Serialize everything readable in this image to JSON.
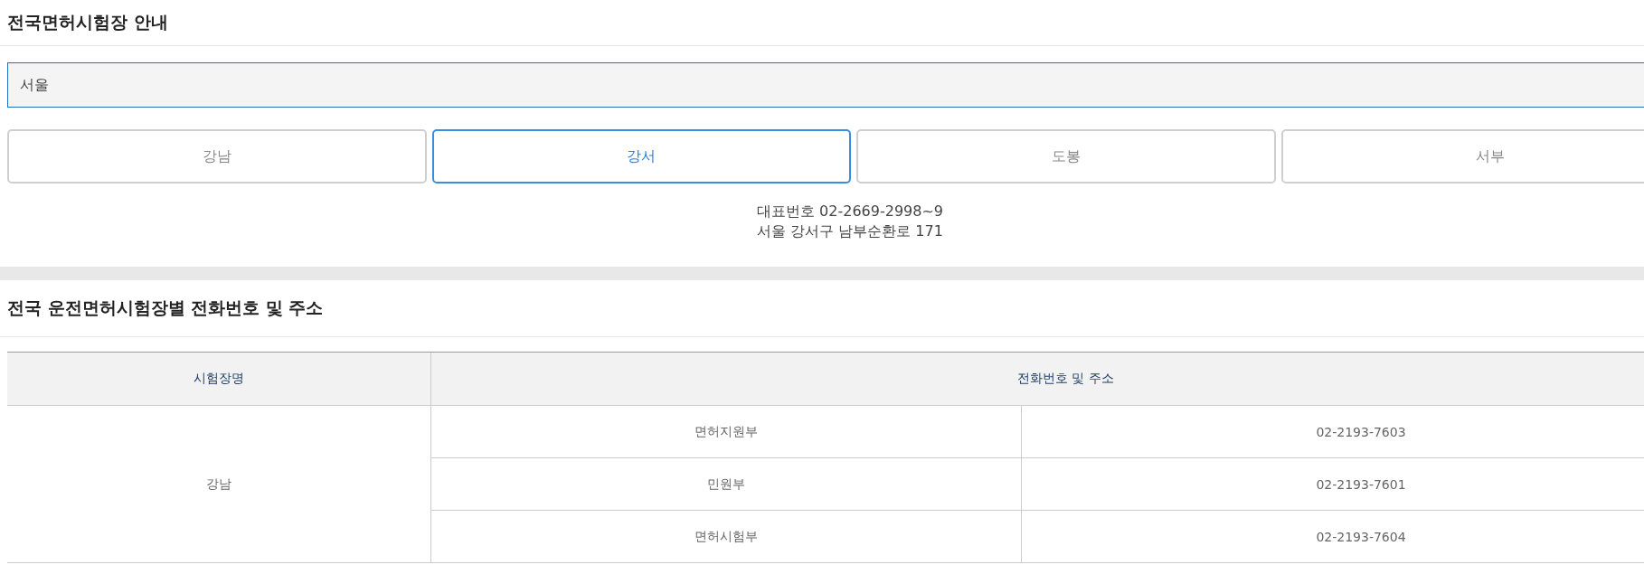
{
  "page_title": "전국면허시험장 안내",
  "region_select": {
    "value": "서울"
  },
  "center_tabs": [
    {
      "label": "강남",
      "selected": false
    },
    {
      "label": "강서",
      "selected": true
    },
    {
      "label": "도봉",
      "selected": false
    },
    {
      "label": "서부",
      "selected": false
    }
  ],
  "center_info": {
    "phone": "대표번호 02-2669-2998~9",
    "address": "서울 강서구 남부순환로 171"
  },
  "section_title": "전국 운전면허시험장별 전화번호 및 주소",
  "table": {
    "columns": [
      "시험장명",
      "전화번호 및 주소"
    ],
    "rows": [
      {
        "center": "강남",
        "departments": [
          {
            "name": "면허지원부",
            "phone": "02-2193-7603"
          },
          {
            "name": "민원부",
            "phone": "02-2193-7601"
          },
          {
            "name": "면허시험부",
            "phone": "02-2193-7604"
          }
        ]
      }
    ]
  }
}
